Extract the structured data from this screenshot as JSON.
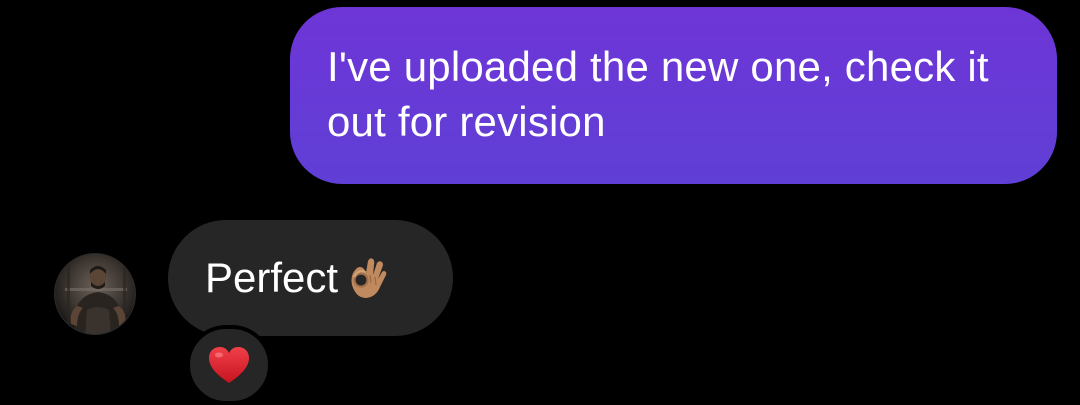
{
  "conversation": {
    "outgoing_message": {
      "text": "I've uploaded the new one, check it out for revision"
    },
    "incoming_message": {
      "text": "Perfect",
      "emoji_icon": "ok-hand-icon"
    },
    "reaction": {
      "icon": "red-heart-icon",
      "color": "#e0202e"
    }
  },
  "colors": {
    "background": "#000000",
    "outgoing_bubble": "#6339d6",
    "incoming_bubble": "#262626",
    "text": "#ffffff"
  }
}
